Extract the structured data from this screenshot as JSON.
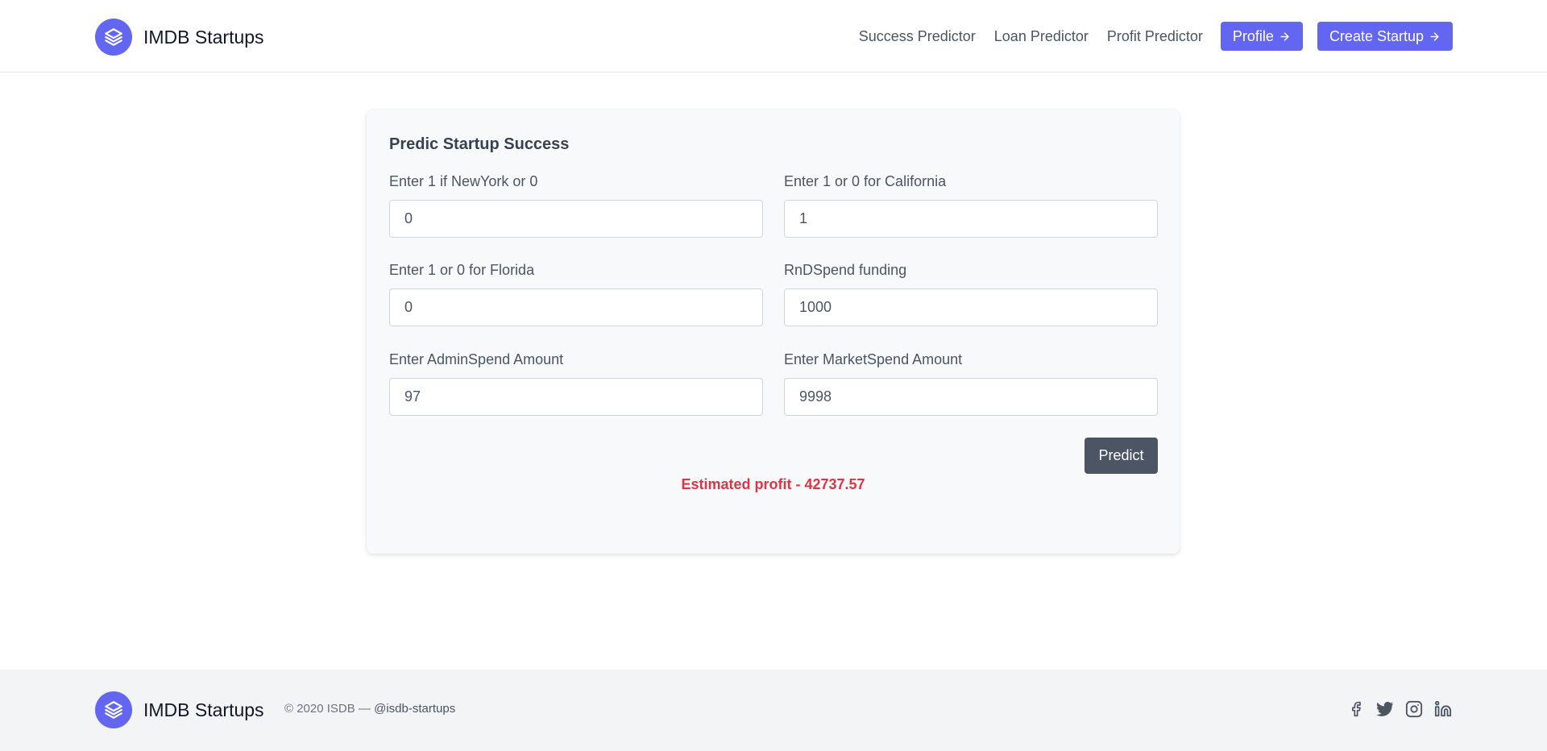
{
  "brand": {
    "name": "IMDB Startups"
  },
  "nav": {
    "links": [
      "Success Predictor",
      "Loan Predictor",
      "Profit Predictor"
    ],
    "profile_button": "Profile",
    "create_button": "Create Startup"
  },
  "form": {
    "title": "Predic Startup Success",
    "fields": [
      {
        "label": "Enter 1 if NewYork or 0",
        "value": "0"
      },
      {
        "label": "Enter 1 or 0 for California",
        "value": "1"
      },
      {
        "label": "Enter 1 or 0 for Florida",
        "value": "0"
      },
      {
        "label": "RnDSpend funding",
        "value": "1000"
      },
      {
        "label": "Enter AdminSpend Amount",
        "value": "97"
      },
      {
        "label": "Enter MarketSpend Amount",
        "value": "9998"
      }
    ],
    "submit_label": "Predict",
    "result_label": "Estimated profit -",
    "result_value": "42737.57"
  },
  "footer": {
    "brand_name": "IMDB Startups",
    "copyright": "© 2020 ISDB —",
    "handle": "@isdb-startups",
    "socials": [
      "facebook-icon",
      "twitter-icon",
      "instagram-icon",
      "linkedin-icon"
    ]
  },
  "colors": {
    "accent": "#6366f1",
    "predict_button": "#4b5563",
    "result": "#dc3545"
  }
}
